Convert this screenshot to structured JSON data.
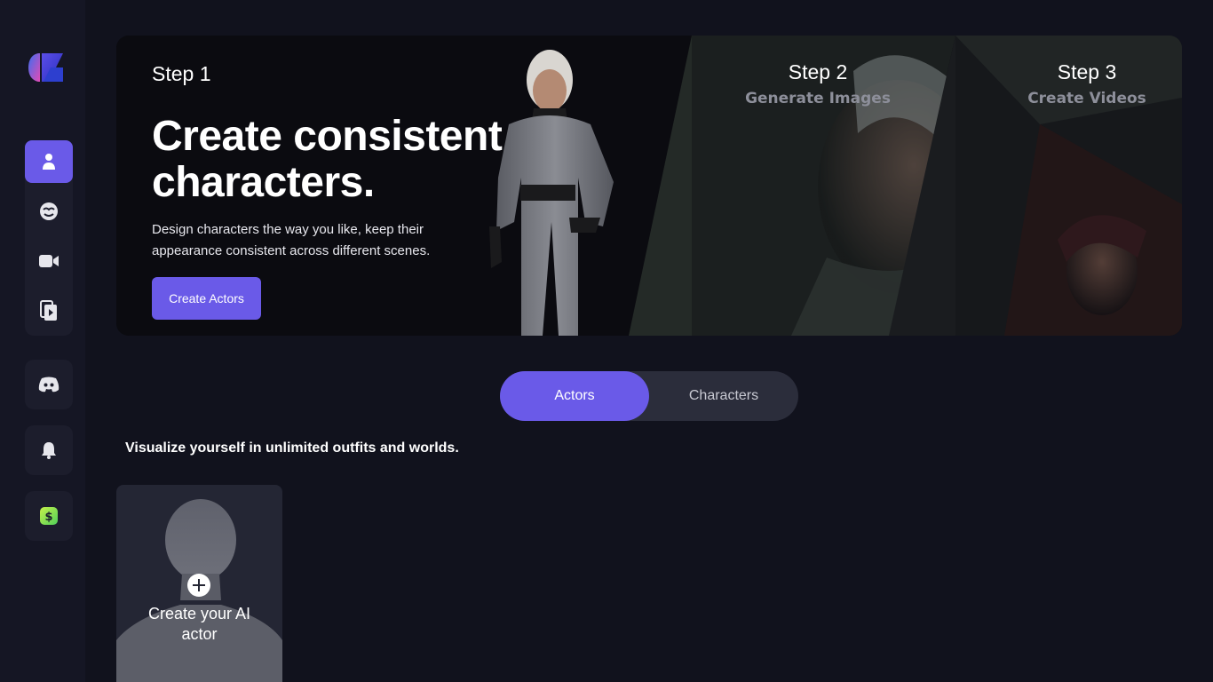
{
  "sidebar": {
    "logo": "brand-logo",
    "nav_items": [
      {
        "name": "actors",
        "icon": "person-icon",
        "active": true
      },
      {
        "name": "characters",
        "icon": "face-icon",
        "active": false
      },
      {
        "name": "videos",
        "icon": "video-camera-icon",
        "active": false
      },
      {
        "name": "library",
        "icon": "media-copy-icon",
        "active": false
      }
    ],
    "discord_icon": "discord-icon",
    "notifications_icon": "bell-icon",
    "pricing_icon": "dollar-icon"
  },
  "hero": {
    "step1_label": "Step 1",
    "title": "Create consistent characters.",
    "description": "Design characters the way you like, keep their appearance consistent across different scenes.",
    "cta_label": "Create Actors",
    "step2": {
      "label": "Step 2",
      "desc": "Generate Images"
    },
    "step3": {
      "label": "Step 3",
      "desc": "Create Videos"
    }
  },
  "tabs": [
    {
      "label": "Actors",
      "active": true
    },
    {
      "label": "Characters",
      "active": false
    }
  ],
  "subtitle": "Visualize yourself in unlimited outfits and worlds.",
  "actor_card": {
    "label": "Create your AI actor",
    "icon": "plus-icon"
  },
  "colors": {
    "accent": "#6a5ae8",
    "background": "#11121d",
    "sidebar": "#151624"
  }
}
